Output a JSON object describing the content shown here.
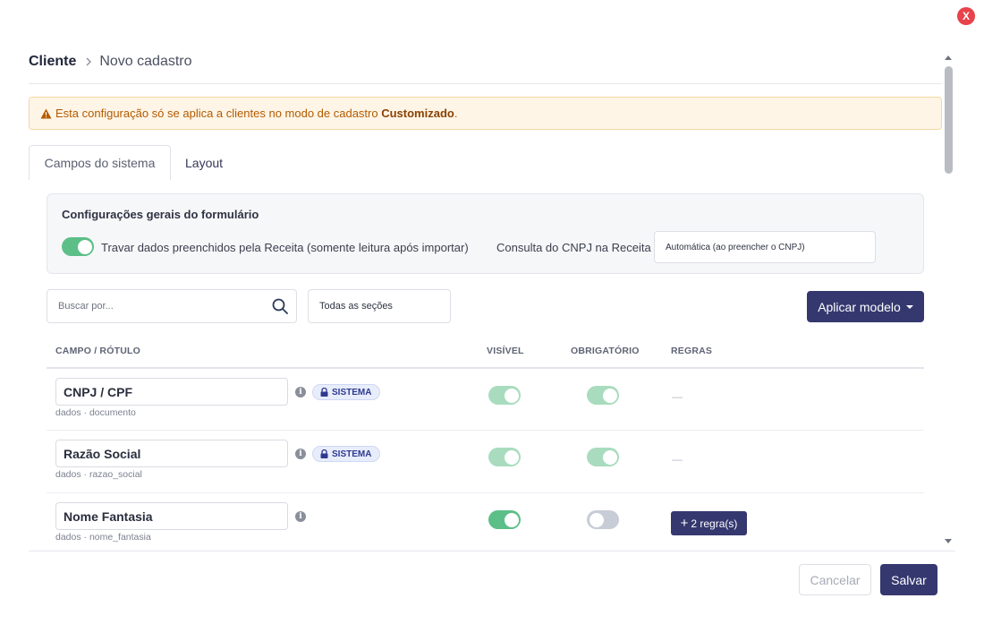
{
  "modal": {
    "close_label": "X"
  },
  "breadcrumb": {
    "root": "Cliente",
    "current": "Novo cadastro"
  },
  "warning": {
    "text_before": "Esta configuração só se aplica a clientes no modo de cadastro ",
    "text_bold": "Customizado",
    "text_after": "."
  },
  "tabs": [
    {
      "label": "Campos do sistema",
      "active": true
    },
    {
      "label": "Layout",
      "active": false
    }
  ],
  "config": {
    "title": "Configurações gerais do formulário",
    "lock_label": "Travar dados preenchidos pela Receita (somente leitura após importar)",
    "lock_enabled": true,
    "cnpj_label": "Consulta do CNPJ na Receita",
    "cnpj_value": "Automática (ao preencher o CNPJ)"
  },
  "search": {
    "placeholder": "Buscar por...",
    "value": ""
  },
  "section_filter": {
    "value": "Todas as seções"
  },
  "apply_model": {
    "label": "Aplicar modelo"
  },
  "table": {
    "headers": {
      "field": "CAMPO / RÓTULO",
      "visible": "VISÍVEL",
      "required": "OBRIGATÓRIO",
      "rules": "REGRAS"
    },
    "rows": [
      {
        "label": "CNPJ / CPF",
        "key": "dados · documento",
        "badge": "SISTEMA",
        "visible": true,
        "required": true,
        "locked": true,
        "rules": "—"
      },
      {
        "label": "Razão Social",
        "key": "dados · razao_social",
        "badge": "SISTEMA",
        "visible": true,
        "required": true,
        "locked": true,
        "rules": "—"
      },
      {
        "label": "Nome Fantasia",
        "key": "dados · nome_fantasia",
        "badge": "",
        "visible": true,
        "required": false,
        "locked": false,
        "rules": "2 regra(s)"
      }
    ]
  },
  "footer": {
    "cancel": "Cancelar",
    "save": "Salvar"
  },
  "colors": {
    "primary": "#35386f",
    "toggle_on": "#5cbf87",
    "warning_bg": "#fff5e6",
    "close": "#e8424a"
  }
}
